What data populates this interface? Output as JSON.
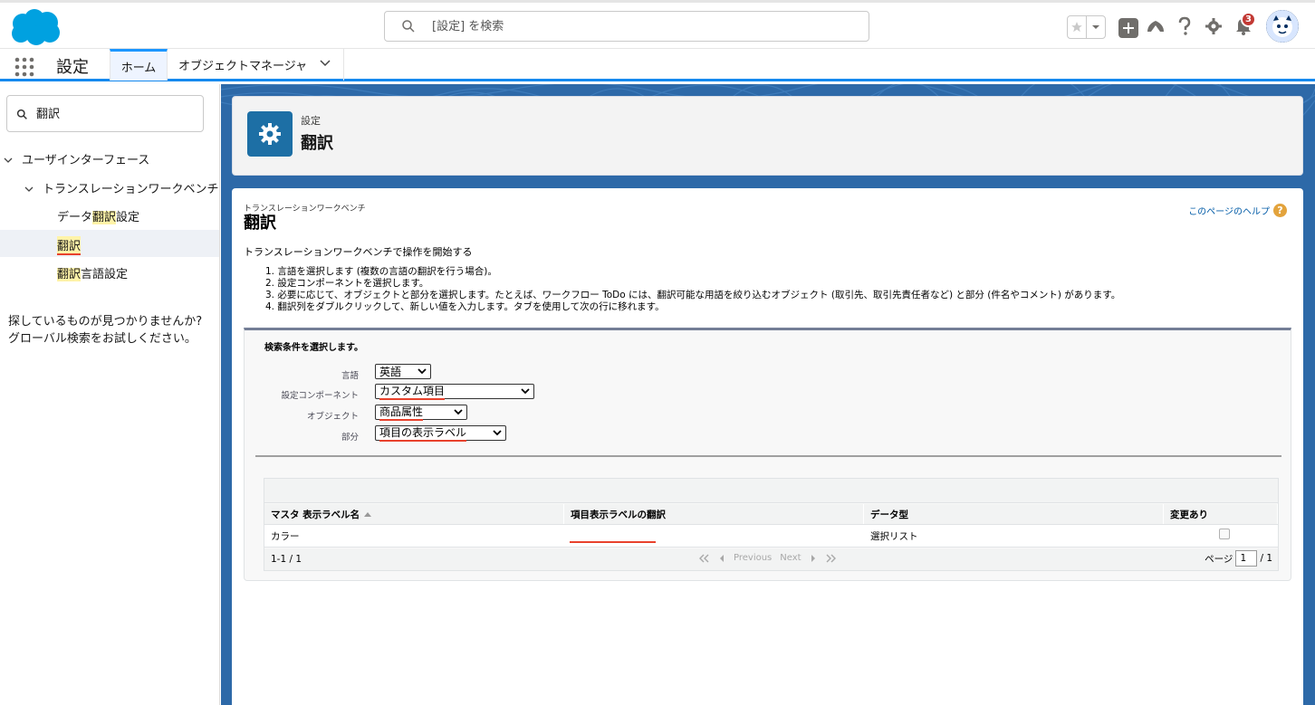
{
  "header": {
    "search_placeholder": "[設定] を検索",
    "notification_count": "3"
  },
  "context": {
    "app_name": "設定",
    "tabs": [
      {
        "label": "ホーム"
      },
      {
        "label": "オブジェクトマネージャ"
      }
    ]
  },
  "sidebar": {
    "quickfind_value": "翻訳",
    "tree": {
      "ui": "ユーザインターフェース",
      "twb": "トランスレーションワークベンチ",
      "item1_pre": "データ",
      "item1_hl": "翻訳",
      "item1_post": "設定",
      "item2_hl": "翻訳",
      "item3_hl": "翻訳",
      "item3_post": "言語設定"
    },
    "not_found_line1": "探しているものが見つかりませんか?",
    "not_found_line2": "グローバル検索をお試しください。"
  },
  "page_header": {
    "breadcrumb": "設定",
    "title": "翻訳"
  },
  "content": {
    "subtitle": "トランスレーションワークベンチ",
    "title": "翻訳",
    "help_link": "このページのヘルプ",
    "intro": "トランスレーションワークベンチで操作を開始する",
    "steps": [
      "1. 言語を選択します (複数の言語の翻訳を行う場合)。",
      "2. 設定コンポーネントを選択します。",
      "3. 必要に応じて、オブジェクトと部分を選択します。たとえば、ワークフロー ToDo には、翻訳可能な用語を絞り込むオブジェクト (取引先、取引先責任者など) と部分 (件名やコメント) があります。",
      "4. 翻訳列をダブルクリックして、新しい値を入力します。タブを使用して次の行に移れます。"
    ]
  },
  "filter": {
    "title": "検索条件を選択します。",
    "language_label": "言語",
    "language_value": "英語",
    "component_label": "設定コンポーネント",
    "component_value": "カスタム項目",
    "object_label": "オブジェクト",
    "object_value": "商品属性",
    "aspect_label": "部分",
    "aspect_value": "項目の表示ラベル"
  },
  "grid": {
    "columns": [
      "マスタ 表示ラベル名",
      "項目表示ラベルの翻訳",
      "データ型",
      "変更あり"
    ],
    "rows": [
      {
        "master": "カラー",
        "translation": "",
        "type": "選択リスト",
        "changed": false
      }
    ],
    "count": "1-1 / 1",
    "previous": "Previous",
    "next": "Next",
    "page_label": "ページ",
    "page_value": "1",
    "page_total": "/ 1"
  },
  "colors": {
    "brand_blue": "#1589ee",
    "header_icon_bg": "#1d6fa5",
    "highlight": "#fff3a8",
    "badge": "#c23934"
  }
}
